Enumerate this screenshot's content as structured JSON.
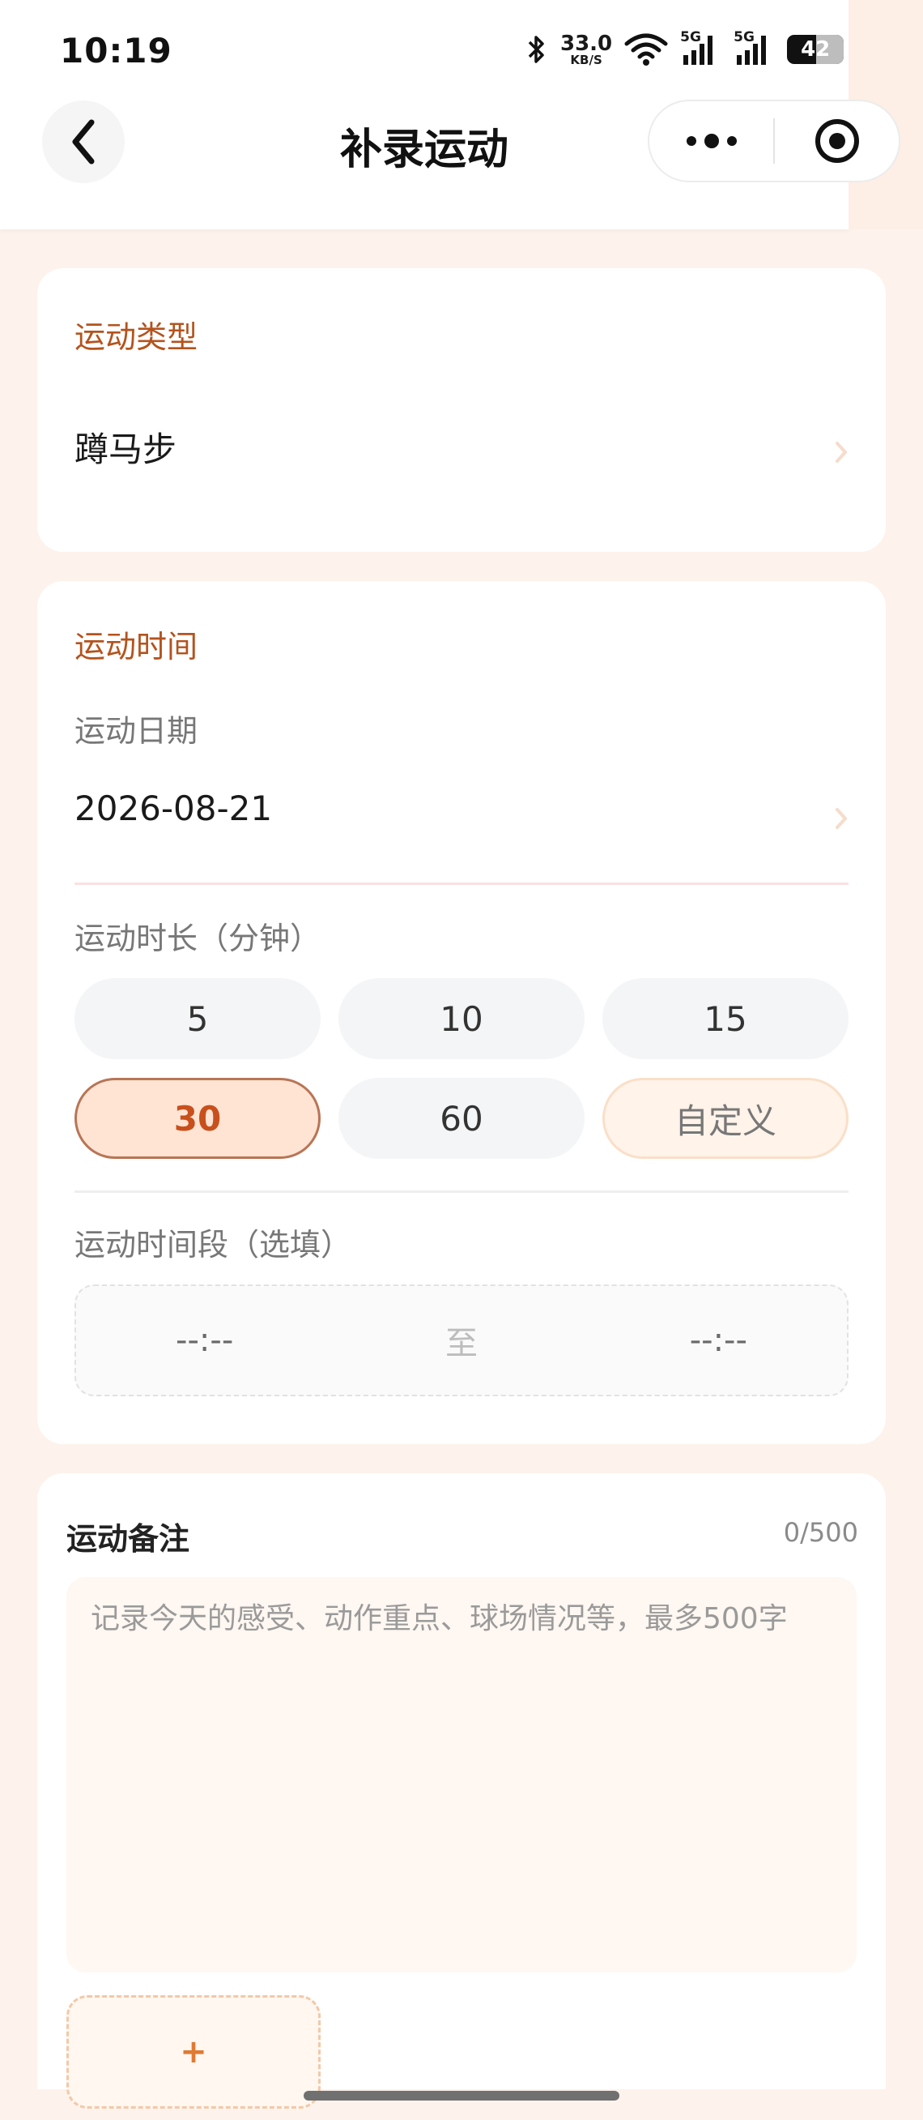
{
  "status": {
    "time": "10:19",
    "speed_value": "33.0",
    "speed_unit": "KB/S",
    "net1": "5G",
    "net2": "5G",
    "battery": "42"
  },
  "nav": {
    "title": "补录运动"
  },
  "sport_type": {
    "section_title": "运动类型",
    "value": "蹲马步"
  },
  "sport_time": {
    "section_title": "运动时间",
    "date_label": "运动日期",
    "date_value": "2026-08-21",
    "duration_label": "运动时长（分钟）",
    "durations": [
      "5",
      "10",
      "15",
      "30",
      "60",
      "自定义"
    ],
    "selected_duration": "30",
    "period_label": "运动时间段（选填）",
    "period_start": "--:--",
    "period_separator": "至",
    "period_end": "--:--"
  },
  "notes": {
    "title": "运动备注",
    "count": "0/500",
    "placeholder": "记录今天的感受、动作重点、球场情况等，最多500字",
    "upload_symbol": "+"
  },
  "colors": {
    "accent": "#b4531d",
    "selected_bg": "#ffe4d4",
    "page_bg": "#fdf2ec"
  }
}
